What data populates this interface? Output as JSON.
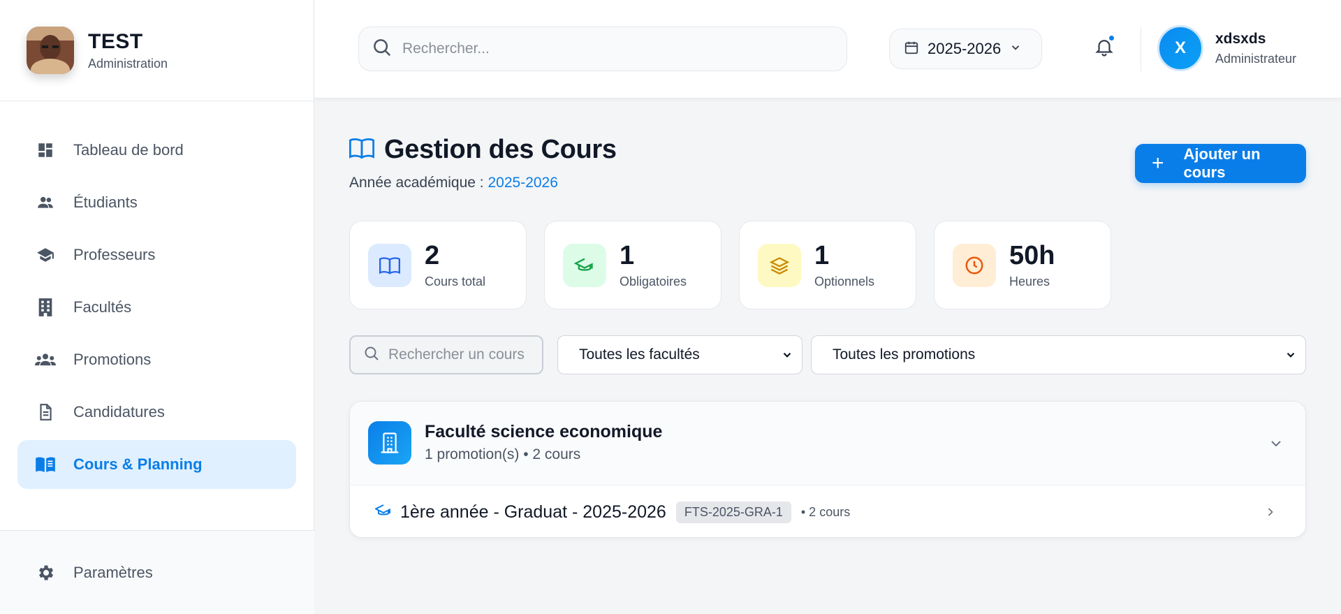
{
  "brand": {
    "title": "TEST",
    "subtitle": "Administration"
  },
  "sidebar": {
    "items": [
      {
        "label": "Tableau de bord",
        "icon": "dashboard-icon"
      },
      {
        "label": "Étudiants",
        "icon": "users-icon"
      },
      {
        "label": "Professeurs",
        "icon": "graduation-cap-icon"
      },
      {
        "label": "Facultés",
        "icon": "building-icon"
      },
      {
        "label": "Promotions",
        "icon": "groups-icon"
      },
      {
        "label": "Candidatures",
        "icon": "document-icon"
      },
      {
        "label": "Cours & Planning",
        "icon": "book-icon",
        "active": true
      }
    ],
    "settings_label": "Paramètres"
  },
  "header": {
    "search_placeholder": "Rechercher...",
    "year": "2025-2026",
    "notifications_unread": true,
    "user": {
      "initial": "X",
      "name": "xdsxds",
      "role": "Administrateur"
    }
  },
  "page": {
    "title": "Gestion des Cours",
    "year_label": "Année académique : ",
    "year_value": "2025-2026",
    "add_button": "Ajouter un cours"
  },
  "stats": [
    {
      "value": "2",
      "label": "Cours total",
      "icon": "book-icon",
      "color": "#2563eb",
      "bg": "#dbeafe"
    },
    {
      "value": "1",
      "label": "Obligatoires",
      "icon": "graduation-cap-icon",
      "color": "#16a34a",
      "bg": "#dcfce7"
    },
    {
      "value": "1",
      "label": "Optionnels",
      "icon": "layers-icon",
      "color": "#ca8a04",
      "bg": "#fef9c3"
    },
    {
      "value": "50h",
      "label": "Heures",
      "icon": "clock-icon",
      "color": "#ea580c",
      "bg": "#ffedd5"
    }
  ],
  "filters": {
    "search_placeholder": "Rechercher un cours",
    "faculty_selected": "Toutes les facultés",
    "promotion_selected": "Toutes les promotions"
  },
  "faculty": {
    "name": "Faculté science economique",
    "meta": "1 promotion(s) • 2 cours",
    "promotions": [
      {
        "name": "1ère année - Graduat - 2025-2026",
        "code": "FTS-2025-GRA-1",
        "count": "• 2 cours"
      }
    ]
  },
  "colors": {
    "accent": "#0a7ee8"
  }
}
